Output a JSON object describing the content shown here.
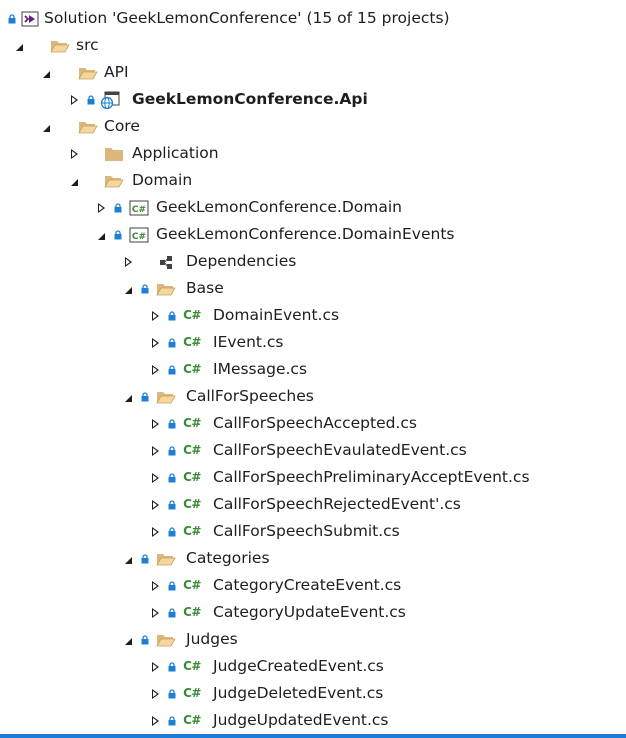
{
  "solution": {
    "label": "Solution 'GeekLemonConference' (15 of 15 projects)",
    "icon": "visual-studio-solution-icon"
  },
  "tree": {
    "src": "src",
    "api": "API",
    "api_project": "GeekLemonConference.Api",
    "core": "Core",
    "application": "Application",
    "domain": "Domain",
    "domain_project": "GeekLemonConference.Domain",
    "domain_events_project": "GeekLemonConference.DomainEvents",
    "dependencies": "Dependencies",
    "base": "Base",
    "base_files": [
      "DomainEvent.cs",
      "IEvent.cs",
      "IMessage.cs"
    ],
    "call_for_speeches": "CallForSpeeches",
    "call_for_speeches_files": [
      "CallForSpeechAccepted.cs",
      "CallForSpeechEvaulatedEvent.cs",
      "CallForSpeechPreliminaryAcceptEvent.cs",
      "CallForSpeechRejectedEvent'.cs",
      "CallForSpeechSubmit.cs"
    ],
    "categories": "Categories",
    "categories_files": [
      "CategoryCreateEvent.cs",
      "CategoryUpdateEvent.cs"
    ],
    "judges": "Judges",
    "judges_files": [
      "JudgeCreatedEvent.cs",
      "JudgeDeletedEvent.cs",
      "JudgeUpdatedEvent.cs"
    ]
  },
  "icons": {
    "folder": "folder-icon",
    "open_folder": "open-folder-icon",
    "lock": "lock-icon",
    "csharp_file": "csharp-file-icon",
    "csharp_project": "csharp-project-icon",
    "web_project": "web-project-icon",
    "dependencies": "dependencies-icon"
  },
  "colors": {
    "folder": "#dcb67a",
    "lock": "#1f7fd6",
    "csharp": "#388a34",
    "accent_bar": "#1c7cd5",
    "vs_purple": "#68217a"
  }
}
